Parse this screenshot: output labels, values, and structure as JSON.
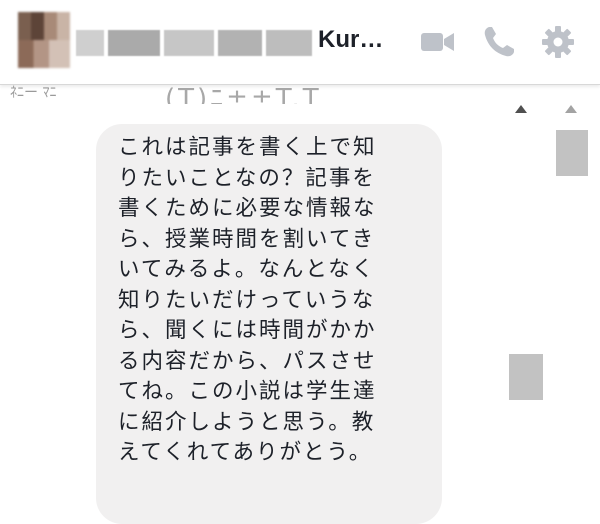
{
  "header": {
    "contact_name": "Kur…",
    "icons": [
      "video-call-icon",
      "phone-icon",
      "gear-icon"
    ],
    "accent_color": "#bec2c9"
  },
  "previous_message_partial": {
    "left": "ﾈﾆー ﾏﾆ",
    "center": "(T)ﾆ±±T.T"
  },
  "message": {
    "lines": [
      "これは記事を書く上で知",
      "りたいことなの？記事を",
      "書くために必要な情報な",
      "ら、授業時間を割いてき",
      "いてみるよ。なんとなく",
      "知りたいだけっていうな",
      "ら、聞くには時間がかか",
      "る内容だから、パスさせ",
      "てね。この小説は学生達",
      "に紹介しようと思う。教",
      "えてくれてありがとう。"
    ],
    "bubble_color": "#f1f0f0"
  }
}
